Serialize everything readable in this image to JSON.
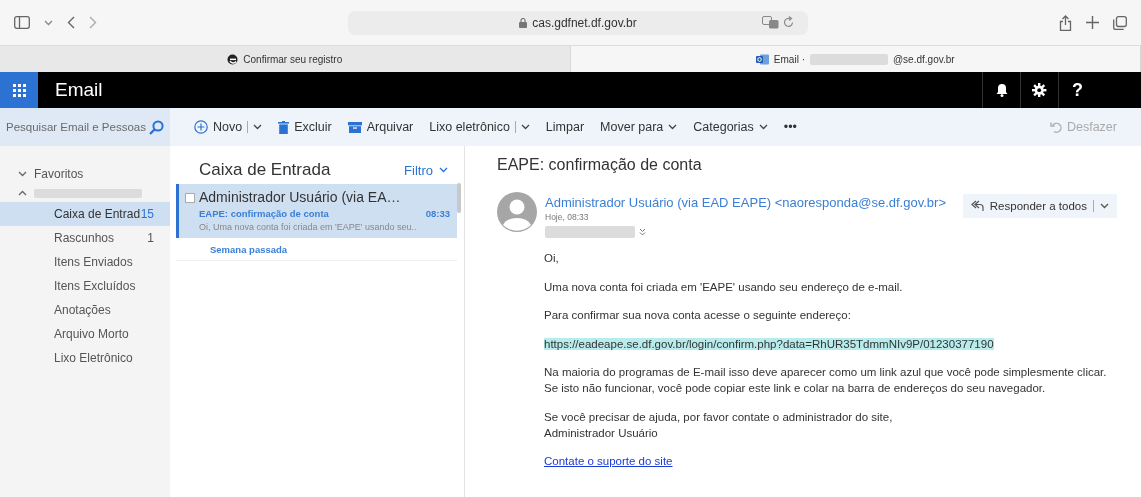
{
  "browser": {
    "address": "cas.gdfnet.df.gov.br",
    "tabs": [
      {
        "title_parts": [
          "Confirmar seu registro"
        ],
        "selected": false
      },
      {
        "title_parts": [
          "Email ·",
          "@se.df.gov.br"
        ],
        "selected": true
      }
    ]
  },
  "app": {
    "title": "Email",
    "help_label": "?"
  },
  "search": {
    "placeholder": "Pesquisar Email e Pessoas"
  },
  "toolbar": [
    {
      "label": "Novo",
      "kind": "split"
    },
    {
      "label": "Excluir",
      "kind": "button"
    },
    {
      "label": "Arquivar",
      "kind": "button"
    },
    {
      "label": "Lixo eletrônico",
      "kind": "split"
    },
    {
      "label": "Limpar",
      "kind": "button"
    },
    {
      "label": "Mover para",
      "kind": "dropdown"
    },
    {
      "label": "Categorias",
      "kind": "dropdown"
    },
    {
      "label": "•••",
      "kind": "button"
    }
  ],
  "undo": {
    "label": "Desfazer",
    "disabled": true
  },
  "sidebar": {
    "favorites_label": "Favoritos",
    "favorites_expanded": true,
    "items": [
      {
        "label": "Caixa de Entrad",
        "count": "15",
        "selected": true
      },
      {
        "label": "Rascunhos",
        "count": "1",
        "selected": false
      },
      {
        "label": "Itens Enviados",
        "selected": false
      },
      {
        "label": "Itens Excluídos",
        "selected": false
      },
      {
        "label": "Anotações",
        "selected": false
      },
      {
        "label": "Arquivo Morto",
        "selected": false
      },
      {
        "label": "Lixo Eletrônico",
        "selected": false
      }
    ]
  },
  "message_list": {
    "title": "Caixa de Entrada",
    "filter": "Filtro",
    "messages": [
      {
        "sender": "Administrador Usuário (via EA…",
        "subject": "EAPE: confirmação de conta",
        "time": "08:33",
        "preview": "Oi,  Uma nova conta foi criada em 'EAPE' usando seu..",
        "selected": true,
        "checked": false
      }
    ],
    "group_header": "Semana passada"
  },
  "reading_pane": {
    "subject": "EAPE: confirmação de conta",
    "from": "Administrador Usuário (via EAD EAPE) <naoresponda@se.df.gov.br>",
    "date": "Hoje, 08:33",
    "reply_all": "Responder a todos",
    "body": [
      {
        "kind": "text",
        "lines": [
          "Oi,"
        ]
      },
      {
        "kind": "text",
        "lines": [
          "Uma nova conta foi criada em 'EAPE' usando seu endereço de e-mail."
        ]
      },
      {
        "kind": "text",
        "lines": [
          "Para confirmar sua nova conta acesse o seguinte endereço:"
        ]
      },
      {
        "kind": "highlight",
        "lines": [
          "https://eadeape.se.df.gov.br/login/confirm.php?data=RhUR35TdmmNIv9P/01230377190"
        ]
      },
      {
        "kind": "text",
        "lines": [
          "Na maioria do programas de E-mail isso deve aparecer como um link azul que você pode simplesmente clicar.",
          "Se isto não funcionar, você pode copiar este link e colar na barra de endereços do seu navegador."
        ]
      },
      {
        "kind": "text",
        "lines": [
          "Se você precisar de ajuda, por favor contate o administrador do site,",
          "Administrador Usuário"
        ]
      },
      {
        "kind": "link",
        "lines": [
          "Contate o suporte do site"
        ]
      }
    ]
  }
}
